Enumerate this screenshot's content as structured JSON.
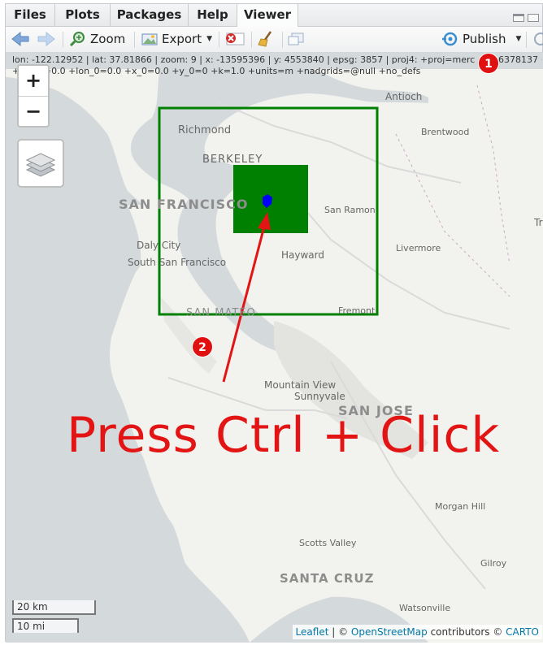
{
  "tabs": [
    {
      "label": "Files"
    },
    {
      "label": "Plots"
    },
    {
      "label": "Packages"
    },
    {
      "label": "Help"
    },
    {
      "label": "Viewer",
      "active": true
    }
  ],
  "toolbar": {
    "zoom_label": "Zoom",
    "export_label": "Export",
    "publish_label": "Publish"
  },
  "coords": {
    "line1": "lon: -122.12952 | lat: 37.81866 | zoom: 9 | x: -13595396 | y: 4553840 | epsg: 3857 | proj4: +proj=merc +a=6378137 +b=6378137",
    "line2": "+lat_ts=0.0 +lon_0=0.0 +x_0=0.0 +y_0=0 +k=1.0 +units=m +nadgrids=@null +no_defs"
  },
  "map": {
    "zoom_in": "+",
    "zoom_out": "−",
    "places": {
      "richmond": "Richmond",
      "berkeley": "BERKELEY",
      "san_francisco": "SAN FRANCISCO",
      "daly_city": "Daly City",
      "south_sf": "South San Francisco",
      "antioch": "Antioch",
      "brentwood": "Brentwood",
      "san_ramon": "San Ramon",
      "livermore": "Livermore",
      "hayward": "Hayward",
      "tr": "Tr",
      "san_mateo": "SAN MATEO",
      "fremont": "Fremont",
      "mountain_view": "Mountain View",
      "sunnyvale": "Sunnyvale",
      "san_jose": "SAN JOSE",
      "morgan_hill": "Morgan Hill",
      "scotts_valley": "Scotts Valley",
      "gilroy": "Gilroy",
      "santa_cruz": "SANTA CRUZ",
      "watsonville": "Watsonville"
    },
    "scale_km": "20 km",
    "scale_mi": "10 mi",
    "attribution": {
      "leaflet": "Leaflet",
      "sep": " | © ",
      "osm": "OpenStreetMap",
      "contrib": " contributors © ",
      "carto": "CARTO"
    }
  },
  "annotations": {
    "badge1": "1",
    "badge2": "2",
    "instruction": "Press Ctrl + Click"
  },
  "colors": {
    "rectangle": "#008000",
    "point": "#0000ff",
    "annotation": "#e31414"
  }
}
